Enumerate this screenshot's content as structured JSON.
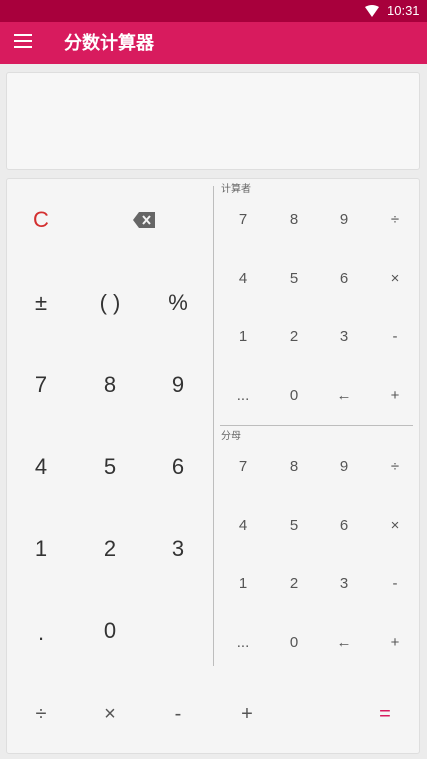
{
  "status_bar": {
    "time": "10:31",
    "wifi_icon": "wifi-icon"
  },
  "app_bar": {
    "title": "分数计算器",
    "menu_icon": "menu-icon"
  },
  "keypad": {
    "main": {
      "clear": "C",
      "backspace_icon": "backspace-icon",
      "plus_minus": "±",
      "parens": "( )",
      "percent": "%",
      "d7": "7",
      "d8": "8",
      "d9": "9",
      "d4": "4",
      "d5": "5",
      "d6": "6",
      "d1": "1",
      "d2": "2",
      "d3": "3",
      "dot": ".",
      "d0": "0"
    },
    "numerator": {
      "label": "计算者",
      "keys": [
        "7",
        "8",
        "9",
        "÷",
        "4",
        "5",
        "6",
        "×",
        "1",
        "2",
        "3",
        "-",
        "...",
        "0",
        "←",
        "+"
      ]
    },
    "denominator": {
      "label": "分母",
      "keys": [
        "7",
        "8",
        "9",
        "÷",
        "4",
        "5",
        "6",
        "×",
        "1",
        "2",
        "3",
        "-",
        "...",
        "0",
        "←",
        "+"
      ]
    },
    "bottom": {
      "divide": "÷",
      "multiply": "×",
      "minus": "-",
      "plus": "+",
      "equals": "="
    }
  },
  "colors": {
    "status_bar": "#a8003c",
    "app_bar": "#d81b5e",
    "clear": "#d32f2f",
    "equals": "#d81b5e"
  }
}
